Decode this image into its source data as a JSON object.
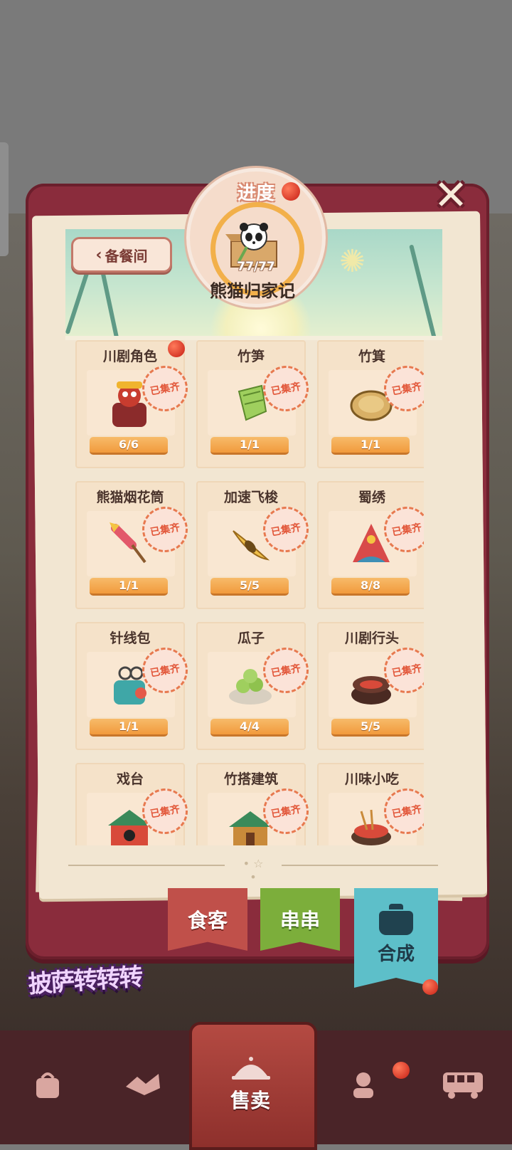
{
  "header": {
    "back_label": "备餐间",
    "progress_title": "进度",
    "progress_count": "77/77",
    "event_title": "熊猫归家记",
    "close_label": "✕"
  },
  "stamp_label": "已集齐",
  "cards": [
    {
      "name": "川剧角色",
      "progress": "6/6",
      "icon": "sichuan-opera-character-icon"
    },
    {
      "name": "竹笋",
      "progress": "1/1",
      "icon": "bamboo-shoot-icon"
    },
    {
      "name": "竹箕",
      "progress": "1/1",
      "icon": "bamboo-basket-icon"
    },
    {
      "name": "熊猫烟花筒",
      "progress": "1/1",
      "icon": "panda-firework-tube-icon"
    },
    {
      "name": "加速飞梭",
      "progress": "5/5",
      "icon": "shuttle-icon"
    },
    {
      "name": "蜀绣",
      "progress": "8/8",
      "icon": "shu-embroidery-icon"
    },
    {
      "name": "针线包",
      "progress": "1/1",
      "icon": "sewing-kit-icon"
    },
    {
      "name": "瓜子",
      "progress": "4/4",
      "icon": "melon-seeds-icon"
    },
    {
      "name": "川剧行头",
      "progress": "5/5",
      "icon": "opera-costume-box-icon"
    },
    {
      "name": "戏台",
      "progress": "",
      "icon": "opera-stage-icon"
    },
    {
      "name": "竹搭建筑",
      "progress": "",
      "icon": "bamboo-building-icon"
    },
    {
      "name": "川味小吃",
      "progress": "",
      "icon": "sichuan-snack-icon"
    }
  ],
  "tabs": {
    "guest": "食客",
    "skewer": "串串",
    "merge": "合成"
  },
  "nav": {
    "sell": "售卖",
    "icons": [
      "bag-icon",
      "handshake-icon",
      "sell-bell-icon",
      "chef-icon",
      "bus-icon"
    ]
  },
  "colors": {
    "frame": "#8a2c3c",
    "progress_bar": "#f19a3c",
    "stamp": "#e2573a",
    "merge_tab": "#5dbfc9"
  }
}
